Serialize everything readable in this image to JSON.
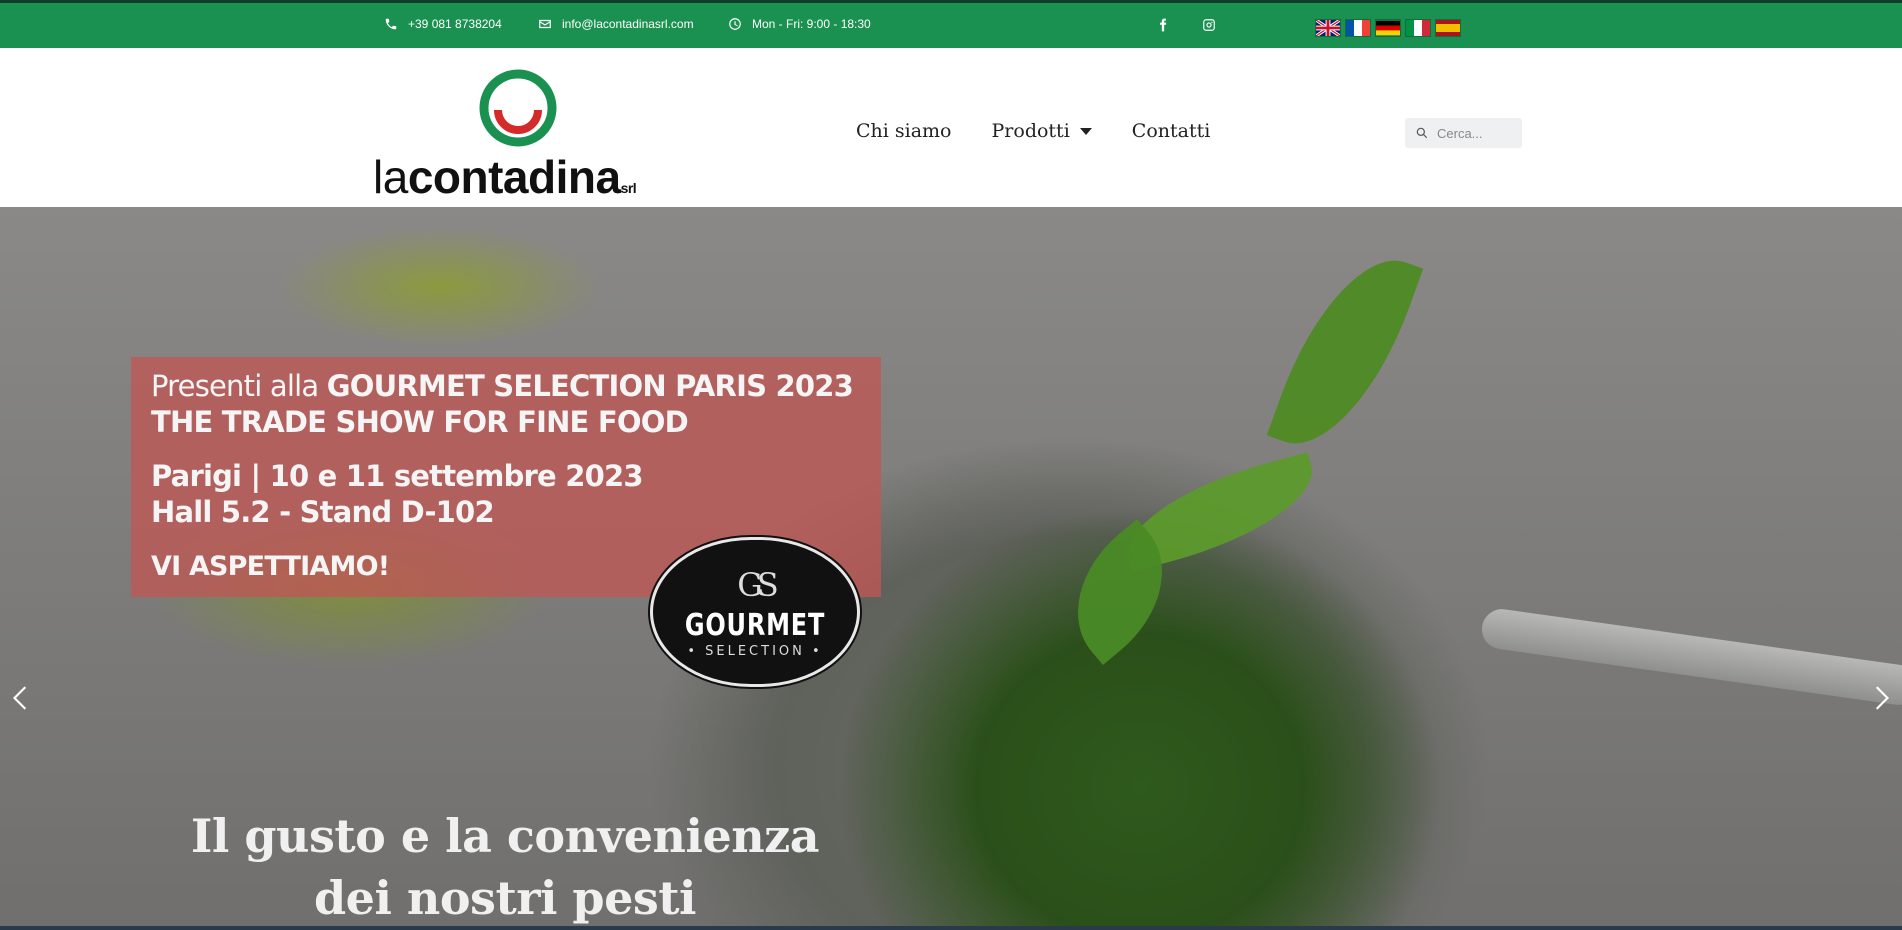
{
  "topbar": {
    "phone": "+39 081 8738204",
    "email": "info@lacontadinasrl.com",
    "hours": "Mon - Fri: 9:00 - 18:30",
    "icons": [
      "phone-icon",
      "envelope-icon",
      "clock-icon",
      "facebook-icon",
      "instagram-icon"
    ],
    "languages": [
      "English",
      "Français",
      "Deutsch",
      "Italiano",
      "Español"
    ],
    "colors": {
      "background": "#1a9150"
    }
  },
  "header": {
    "logo": {
      "la": "la",
      "name": "contadina",
      "suffix": "srl"
    },
    "nav": {
      "chi_siamo": "Chi siamo",
      "prodotti": "Prodotti",
      "contatti": "Contatti"
    },
    "search": {
      "placeholder": "Cerca..."
    }
  },
  "hero": {
    "promo": {
      "line1_prefix": "Presenti alla ",
      "line1_bold": "GOURMET SELECTION PARIS 2023",
      "line2": "THE TRADE SHOW FOR FINE FOOD",
      "line3": "Parigi | 10 e 11 settembre 2023",
      "line4": "Hall 5.2 - Stand D-102",
      "line5": "VI ASPETTIAMO!",
      "background": "#bf5754"
    },
    "badge": {
      "monogram": "GS",
      "title": "GOURMET",
      "subtitle": "• SELECTION •"
    },
    "caption": {
      "line1": "Il gusto e la convenienza",
      "line2": "dei nostri pesti"
    }
  }
}
